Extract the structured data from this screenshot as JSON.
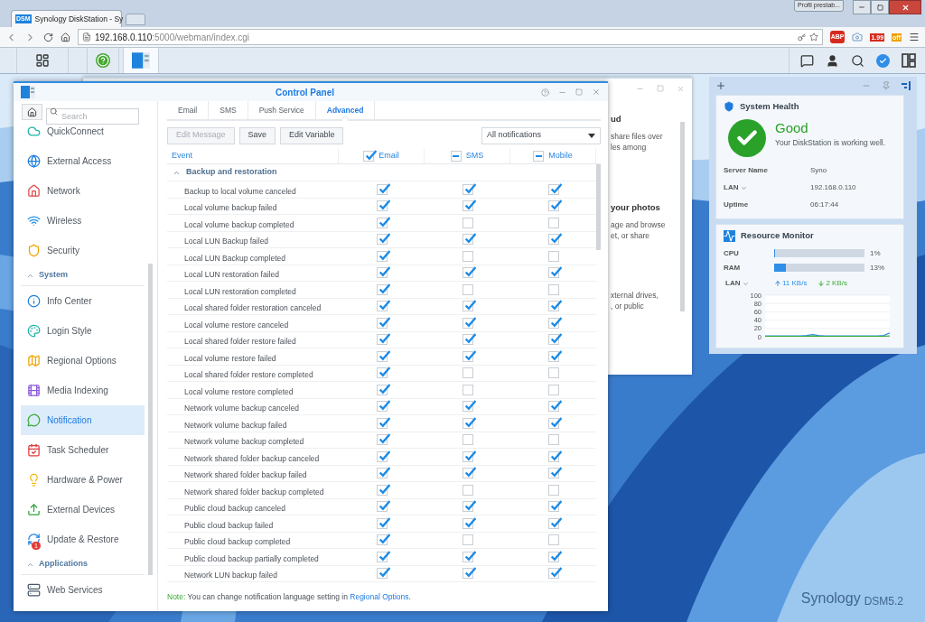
{
  "browser": {
    "favicon_text": "DSM",
    "tab_title": "Synology DiskStation - Sy",
    "profile_button": "Profil prestab...",
    "url_host": "192.168.0.110",
    "url_path": ":5000/webman/index.cgi",
    "abp_label": "ABP",
    "price_badge": "1.99",
    "toggle_badge": "off"
  },
  "taskbar": {
    "apps": [
      {
        "kind": "main_menu",
        "selected": false
      },
      {
        "kind": "help",
        "selected": false
      },
      {
        "kind": "control_panel",
        "selected": true
      }
    ]
  },
  "background_window": {
    "lines": [
      {
        "kind": "heading",
        "text": "ud"
      },
      {
        "kind": "line",
        "text": "share files over"
      },
      {
        "kind": "line",
        "text": "les among"
      },
      {
        "kind": "gap"
      },
      {
        "kind": "heading",
        "text": "your photos"
      },
      {
        "kind": "line",
        "text": "age and browse"
      },
      {
        "kind": "line",
        "text": "et, or share"
      },
      {
        "kind": "gap"
      },
      {
        "kind": "line",
        "text": "xternal drives,"
      },
      {
        "kind": "line",
        "text": ", or public"
      }
    ]
  },
  "control_panel": {
    "title": "Control Panel",
    "sidebar": {
      "search_placeholder": "Search",
      "items": [
        {
          "kind": "item",
          "label": "QuickConnect",
          "selected": false
        },
        {
          "kind": "item",
          "label": "External Access",
          "selected": false
        },
        {
          "kind": "item",
          "label": "Network",
          "selected": false
        },
        {
          "kind": "item",
          "label": "Wireless",
          "selected": false
        },
        {
          "kind": "item",
          "label": "Security",
          "selected": false
        },
        {
          "kind": "section",
          "label": "System",
          "expanded": true
        },
        {
          "kind": "item",
          "label": "Info Center",
          "selected": false
        },
        {
          "kind": "item",
          "label": "Login Style",
          "selected": false
        },
        {
          "kind": "item",
          "label": "Regional Options",
          "selected": false
        },
        {
          "kind": "item",
          "label": "Media Indexing",
          "selected": false
        },
        {
          "kind": "item",
          "label": "Notification",
          "selected": true
        },
        {
          "kind": "item",
          "label": "Task Scheduler",
          "selected": false
        },
        {
          "kind": "item",
          "label": "Hardware & Power",
          "selected": false
        },
        {
          "kind": "item",
          "label": "External Devices",
          "selected": false
        },
        {
          "kind": "item",
          "label": "Update & Restore",
          "selected": false,
          "badge": "1"
        },
        {
          "kind": "section",
          "label": "Applications",
          "expanded": true
        },
        {
          "kind": "item",
          "label": "Web Services",
          "selected": false
        }
      ]
    },
    "tabs": [
      {
        "label": "Email",
        "selected": false
      },
      {
        "label": "SMS",
        "selected": false
      },
      {
        "label": "Push Service",
        "selected": false
      },
      {
        "label": "Advanced",
        "selected": true
      }
    ],
    "toolbar": [
      {
        "label": "Edit Message",
        "disabled": true
      },
      {
        "label": "Save",
        "disabled": false
      },
      {
        "label": "Edit Variable",
        "disabled": false
      }
    ],
    "filter": {
      "value": "All notifications"
    },
    "columns": [
      {
        "label": "Event",
        "kind": "text"
      },
      {
        "label": "Email",
        "kind": "check",
        "checked": true
      },
      {
        "label": "SMS",
        "kind": "check",
        "indeterminate": true
      },
      {
        "label": "Mobile",
        "kind": "check",
        "indeterminate": true
      }
    ],
    "group": {
      "label": "Backup and restoration",
      "expanded": true
    },
    "rows": [
      {
        "event": "Backup to local volume canceled",
        "email": true,
        "sms": true,
        "mobile": true
      },
      {
        "event": "Local volume backup failed",
        "email": true,
        "sms": true,
        "mobile": true
      },
      {
        "event": "Local volume backup completed",
        "email": true,
        "sms": false,
        "mobile": false
      },
      {
        "event": "Local LUN Backup failed",
        "email": true,
        "sms": true,
        "mobile": true
      },
      {
        "event": "Local LUN Backup completed",
        "email": true,
        "sms": false,
        "mobile": false
      },
      {
        "event": "Local LUN restoration failed",
        "email": true,
        "sms": true,
        "mobile": true
      },
      {
        "event": "Local LUN restoration completed",
        "email": true,
        "sms": false,
        "mobile": false
      },
      {
        "event": "Local shared folder restoration canceled",
        "email": true,
        "sms": true,
        "mobile": true
      },
      {
        "event": "Local volume restore canceled",
        "email": true,
        "sms": true,
        "mobile": true
      },
      {
        "event": "Local shared folder restore failed",
        "email": true,
        "sms": true,
        "mobile": true
      },
      {
        "event": "Local volume restore failed",
        "email": true,
        "sms": true,
        "mobile": true
      },
      {
        "event": "Local shared folder restore completed",
        "email": true,
        "sms": false,
        "mobile": false
      },
      {
        "event": "Local volume restore completed",
        "email": true,
        "sms": false,
        "mobile": false
      },
      {
        "event": "Network volume backup canceled",
        "email": true,
        "sms": true,
        "mobile": true
      },
      {
        "event": "Network volume backup failed",
        "email": true,
        "sms": true,
        "mobile": true
      },
      {
        "event": "Network volume backup completed",
        "email": true,
        "sms": false,
        "mobile": false
      },
      {
        "event": "Network shared folder backup canceled",
        "email": true,
        "sms": true,
        "mobile": true
      },
      {
        "event": "Network shared folder backup failed",
        "email": true,
        "sms": true,
        "mobile": true
      },
      {
        "event": "Network shared folder backup completed",
        "email": true,
        "sms": false,
        "mobile": false
      },
      {
        "event": "Public cloud backup canceled",
        "email": true,
        "sms": true,
        "mobile": true
      },
      {
        "event": "Public cloud backup failed",
        "email": true,
        "sms": true,
        "mobile": true
      },
      {
        "event": "Public cloud backup completed",
        "email": true,
        "sms": false,
        "mobile": false
      },
      {
        "event": "Public cloud backup partially completed",
        "email": true,
        "sms": true,
        "mobile": true
      },
      {
        "event": "Network LUN backup failed",
        "email": true,
        "sms": true,
        "mobile": true
      }
    ],
    "note": {
      "prefix": "Note:",
      "text": " You can change notification language setting in ",
      "link": "Regional Options",
      "end": "."
    }
  },
  "widgets": {
    "system_health": {
      "title": "System Health",
      "status": "Good",
      "message": "Your DiskStation is working well.",
      "fields": [
        {
          "label": "Server Name",
          "value": "Syno",
          "dropdown": false
        },
        {
          "label": "LAN",
          "value": "192.168.0.110",
          "dropdown": true
        },
        {
          "label": "Uptime",
          "value": "06:17:44",
          "dropdown": false
        }
      ]
    },
    "resource_monitor": {
      "title": "Resource Monitor",
      "meters": [
        {
          "label": "CPU",
          "level": 0.01,
          "reading": "1%"
        },
        {
          "label": "RAM",
          "level": 0.13,
          "reading": "13%"
        }
      ],
      "lan": {
        "label": "LAN",
        "upload": "11 KB/s",
        "download": "2 KB/s"
      },
      "chart_data": {
        "type": "line",
        "grid": true,
        "ylim": [
          0,
          100
        ],
        "yticks": [
          0,
          20,
          40,
          60,
          80,
          100
        ],
        "series": [
          {
            "color": "#2f8ee8",
            "values": [
              2,
              2,
              2,
              2,
              2,
              2,
              2,
              3,
              5,
              3,
              2,
              2,
              2,
              2,
              2,
              2,
              2,
              2,
              2,
              2,
              3,
              9
            ]
          },
          {
            "color": "#3aaa35",
            "values": [
              1,
              1,
              1,
              1,
              1,
              1,
              1,
              1,
              2,
              1,
              1,
              1,
              1,
              1,
              1,
              1,
              1,
              1,
              1,
              1,
              1,
              2
            ]
          }
        ]
      }
    }
  },
  "desktop": {
    "brand": "Synology",
    "version": "DSM5.2"
  }
}
